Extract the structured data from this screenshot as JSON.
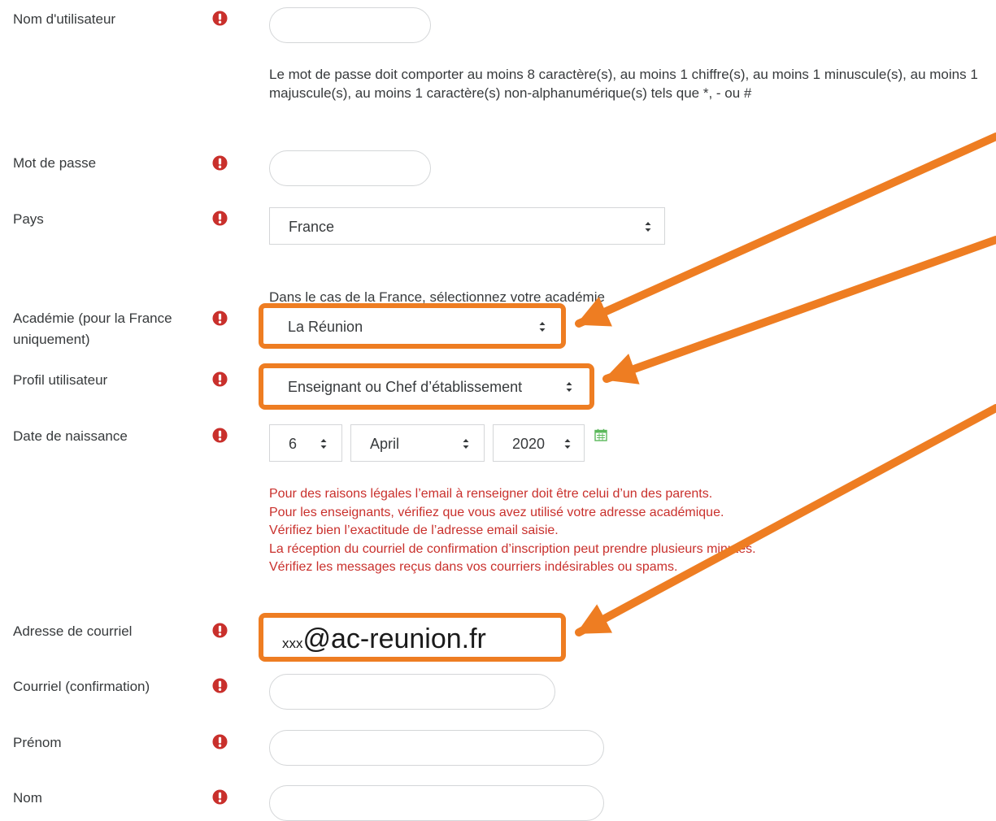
{
  "colors": {
    "required": "#c9302c",
    "warning": "#c9302c",
    "annotation": "#ee7d22",
    "border": "#d4d6d8",
    "text": "#373a3c"
  },
  "icons": {
    "required": "exclamation-circle-icon",
    "select_caret": "updown-caret-icon",
    "calendar": "calendar-icon",
    "annotation": "arrow-icon"
  },
  "form": {
    "username": {
      "label": "Nom d'utilisateur",
      "value": ""
    },
    "password_policy": "Le mot de passe doit comporter au moins 8 caractère(s), au moins 1 chiffre(s), au moins 1 minuscule(s), au moins 1 majuscule(s), au moins 1 caractère(s) non-alphanumérique(s) tels que *, - ou #",
    "password": {
      "label": "Mot de passe",
      "value": ""
    },
    "country": {
      "label": "Pays",
      "value": "France"
    },
    "academy_hint": "Dans le cas de la France, sélectionnez votre académie",
    "academy": {
      "label_line1": "Académie (pour la France",
      "label_line2": "uniquement)",
      "value": "La Réunion"
    },
    "profile": {
      "label": "Profil utilisateur",
      "value": "Enseignant ou Chef d’établissement"
    },
    "birthdate": {
      "label": "Date de naissance",
      "day": "6",
      "month": "April",
      "year": "2020"
    },
    "warnings": [
      "Pour des raisons légales l’email à renseigner doit être celui d’un des parents.",
      "Pour les enseignants, vérifiez que vous avez utilisé votre adresse académique.",
      "Vérifiez bien l’exactitude de l’adresse email saisie.",
      "La réception du courriel de confirmation d’inscription peut prendre plusieurs minutes.",
      "Vérifiez les messages reçus dans vos courriers indésirables ou spams."
    ],
    "email": {
      "label": "Adresse de courriel",
      "value_prefix": "xxx",
      "value_domain": "@ac-reunion.fr"
    },
    "email_confirm": {
      "label": "Courriel (confirmation)",
      "value": ""
    },
    "firstname": {
      "label": "Prénom",
      "value": ""
    },
    "lastname": {
      "label": "Nom",
      "value": ""
    }
  }
}
